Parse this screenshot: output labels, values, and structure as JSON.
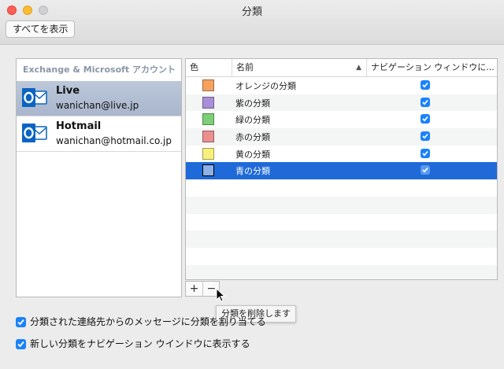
{
  "window": {
    "title": "分類"
  },
  "toolbar": {
    "show_all_label": "すべてを表示"
  },
  "accounts": {
    "header": "Exchange & Microsoft アカウント",
    "items": [
      {
        "name": "Live",
        "email": "wanichan@live.jp",
        "selected": true
      },
      {
        "name": "Hotmail",
        "email": "wanichan@hotmail.co.jp",
        "selected": false
      }
    ]
  },
  "categories": {
    "columns": {
      "color": "色",
      "name": "名前",
      "nav": "ナビゲーション ウィンドウに..."
    },
    "rows": [
      {
        "name": "オレンジの分類",
        "color": "#f5a25f",
        "nav_checked": true
      },
      {
        "name": "紫の分類",
        "color": "#a98ed9",
        "nav_checked": true
      },
      {
        "name": "緑の分類",
        "color": "#7ccf76",
        "nav_checked": true
      },
      {
        "name": "赤の分類",
        "color": "#eb8f8f",
        "nav_checked": true
      },
      {
        "name": "黄の分類",
        "color": "#f8f07c",
        "nav_checked": true
      },
      {
        "name": "青の分類",
        "color": "#8db1e8",
        "nav_checked": true,
        "selected": true
      }
    ]
  },
  "buttons": {
    "add_label": "+",
    "remove_label": "−"
  },
  "tooltip": {
    "text": "分類を削除します"
  },
  "options": [
    {
      "label": "分類された連絡先からのメッセージに分類を割り当てる",
      "checked": true
    },
    {
      "label": "新しい分類をナビゲーション ウインドウに表示する",
      "checked": true
    }
  ],
  "colors": {
    "accent": "#1f6ad8",
    "checkbox": "#1a82fb",
    "outlook": "#0a64c2"
  }
}
